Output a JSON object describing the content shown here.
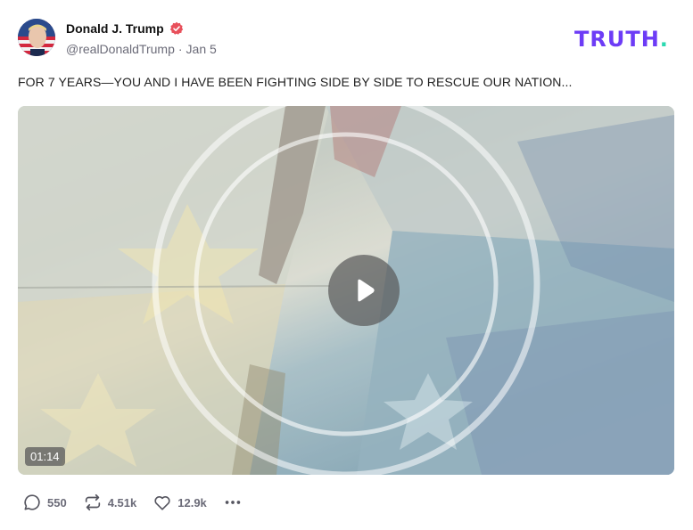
{
  "author": {
    "display_name": "Donald J. Trump",
    "handle": "@realDonaldTrump",
    "separator": "·",
    "date": "Jan 5",
    "verified": true
  },
  "brand": {
    "logo_text": "TRUTH.",
    "logo_color": "#6d3cf6",
    "dot_color": "#2bd9b0"
  },
  "post": {
    "text": "FOR 7 YEARS—YOU AND I HAVE BEEN FIGHTING SIDE BY SIDE TO RESCUE OUR NATION...",
    "video": {
      "duration": "01:14"
    }
  },
  "actions": {
    "reply_count": "550",
    "retruth_count": "4.51k",
    "like_count": "12.9k"
  },
  "icons": {
    "reply": "comment-bubble-icon",
    "retruth": "repost-icon",
    "like": "heart-icon",
    "more": "more-horizontal-icon",
    "verified": "verified-badge-icon",
    "play": "play-icon"
  },
  "colors": {
    "muted_text": "#6b6b78",
    "verified_badge": "#e8505b"
  }
}
